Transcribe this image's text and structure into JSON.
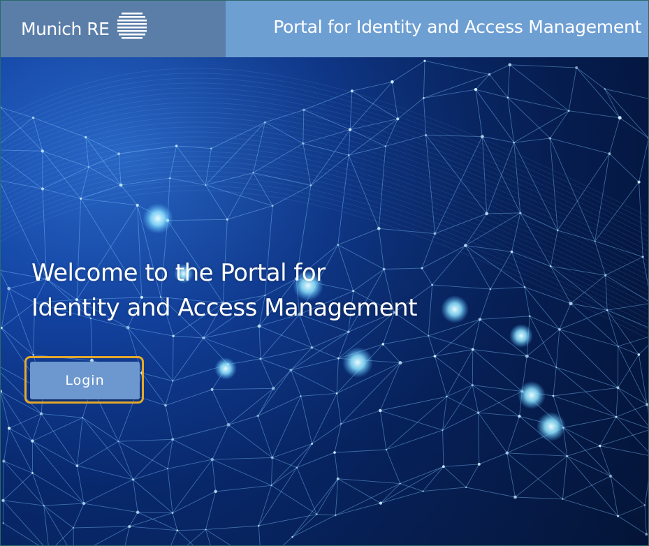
{
  "header": {
    "brand_name": "Munich RE",
    "portal_title": "Portal for Identity and Access Management"
  },
  "hero": {
    "welcome_line1": "Welcome to the Portal for",
    "welcome_line2": "Identity and Access Management",
    "login_label": "Login"
  },
  "icons": {
    "logo": "munich-re-stripes-logo",
    "background": "network-mesh-illustration"
  },
  "colors": {
    "logo_bg": "#5b7ea9",
    "title_bg": "#6e9fd3",
    "button_bg": "#6d98cf",
    "focus_ring": "#e5a92b"
  }
}
